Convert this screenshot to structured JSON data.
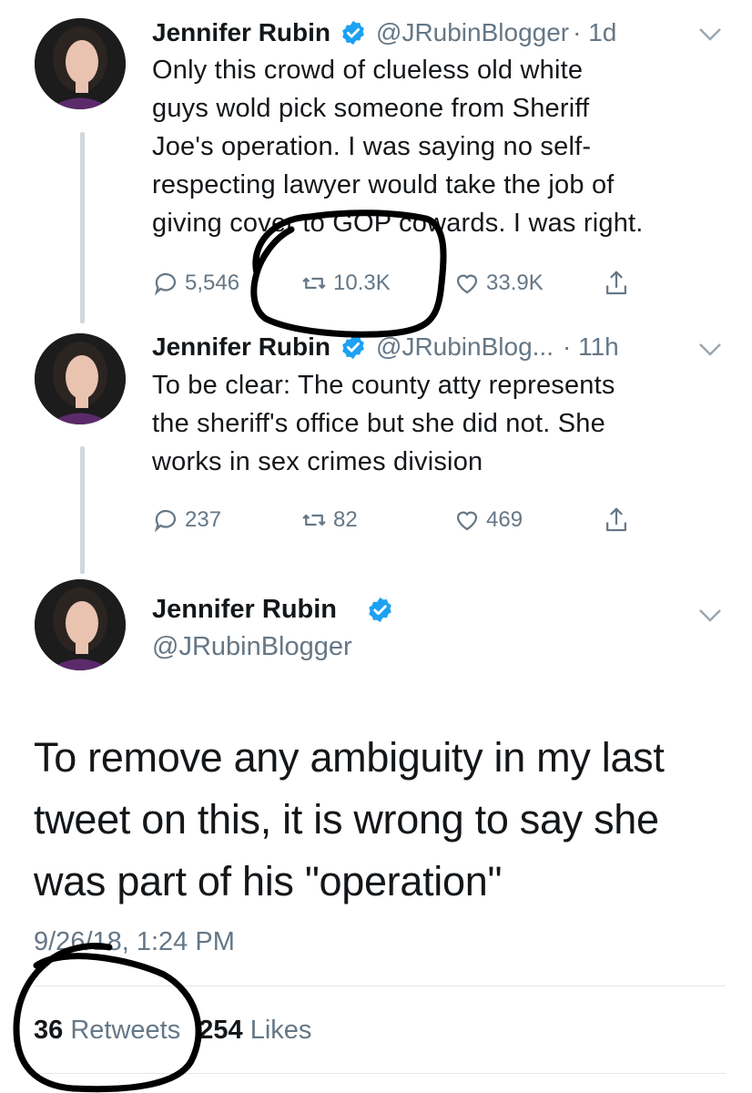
{
  "colors": {
    "text": "#14171a",
    "secondary": "#657786",
    "verified": "#1da1f2",
    "thread_line": "#cfd8dc",
    "annotation_ink": "#000000"
  },
  "tweets": [
    {
      "author_name": "Jennifer Rubin",
      "handle": "@JRubinBlogger",
      "time": "· 1d",
      "text": "Only this crowd of clueless old white\nguys wold pick someone from Sheriff\nJoe's operation. I was saying no self-\nrespecting lawyer would take the job of\ngiving cover to GOP cowards. I was right.",
      "replies": "5,546",
      "retweets": "10.3K",
      "likes": "33.9K",
      "icons": [
        "reply-icon",
        "retweet-icon",
        "like-icon",
        "share-icon",
        "verified-badge-icon",
        "chevron-down-icon"
      ]
    },
    {
      "author_name": "Jennifer Rubin",
      "handle": "@JRubinBlog...",
      "time": "· 11h",
      "text": "To be clear: The county atty represents\nthe sheriff's office but she did not. She\nworks in sex crimes division",
      "replies": "237",
      "retweets": "82",
      "likes": "469"
    }
  ],
  "main_tweet": {
    "author_name": "Jennifer Rubin",
    "handle": "@JRubinBlogger",
    "text": "To remove any ambiguity in my last\ntweet on this, it is wrong to say she\nwas part of his \"operation\"",
    "timestamp": "9/26/18, 1:24 PM",
    "retweet_count": "36",
    "retweet_label": "Retweets",
    "like_count": "254",
    "like_label": "Likes"
  }
}
